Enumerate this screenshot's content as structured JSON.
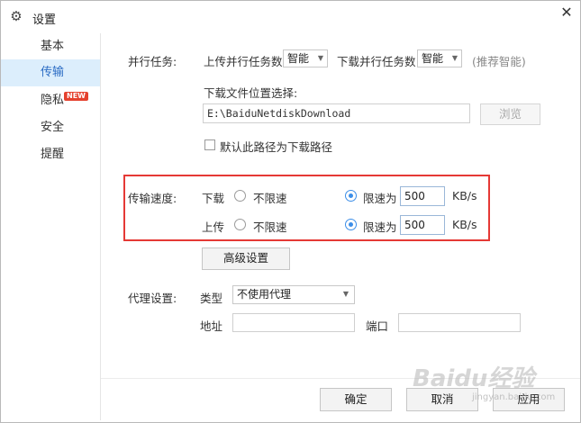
{
  "window": {
    "title": "设置",
    "close_glyph": "✕",
    "settings_icon": "gear-icon"
  },
  "sidebar": {
    "items": [
      {
        "label": "基本"
      },
      {
        "label": "传输"
      },
      {
        "label": "隐私",
        "badge": "NEW"
      },
      {
        "label": "安全"
      },
      {
        "label": "提醒"
      }
    ],
    "active_index": 1
  },
  "parallel": {
    "label": "并行任务:",
    "upload_label": "上传并行任务数",
    "upload_value": "智能",
    "download_label": "下载并行任务数",
    "download_value": "智能",
    "hint": "(推荐智能)"
  },
  "download_path": {
    "label": "下载文件位置选择:",
    "value": "E:\\BaiduNetdiskDownload",
    "browse_label": "浏览",
    "default_checkbox_label": "默认此路径为下载路径",
    "default_checked": false
  },
  "speed": {
    "label": "传输速度:",
    "download_label": "下载",
    "upload_label": "上传",
    "unlimited_label": "不限速",
    "limit_label": "限速为",
    "download_limit": "500",
    "upload_limit": "500",
    "unit": "KB/s",
    "download_mode": "limit",
    "upload_mode": "limit"
  },
  "advanced_button": "高级设置",
  "proxy": {
    "label": "代理设置:",
    "type_label": "类型",
    "type_value": "不使用代理",
    "address_label": "地址",
    "address_value": "",
    "port_label": "端口",
    "port_value": ""
  },
  "footer": {
    "ok": "确定",
    "cancel": "取消",
    "apply": "应用"
  },
  "watermark": {
    "main": "Baidu经验",
    "sub": "jingyan.baidu.com"
  },
  "colors": {
    "active_bg": "#dceefc",
    "active_text": "#2b6cc4",
    "highlight_box": "#e53935",
    "radio_checked": "#3c8ee8",
    "badge": "#e5412e"
  }
}
